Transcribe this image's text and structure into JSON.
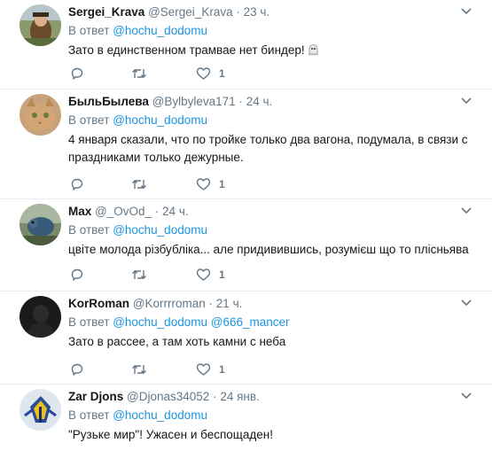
{
  "tweets": [
    {
      "name": "Sergei_Krava",
      "handle": "@Sergei_Krava",
      "dot": "·",
      "time": "23 ч.",
      "reply_prefix": "В ответ",
      "mentions": [
        "@hochu_dodomu"
      ],
      "text": "Зато в единственном трамвае нет биндер!",
      "emoji": "ghost-emoji",
      "likes": "1"
    },
    {
      "name": "БыльБылева",
      "handle": "@Bylbyleva171",
      "dot": "·",
      "time": "24 ч.",
      "reply_prefix": "В ответ",
      "mentions": [
        "@hochu_dodomu"
      ],
      "text": "4 января сказали, что по тройке только два вагона, подумала, в связи с праздниками только дежурные.",
      "likes": "1"
    },
    {
      "name": "Max",
      "handle": "@_OvOd_",
      "dot": "·",
      "time": "24 ч.",
      "reply_prefix": "В ответ",
      "mentions": [
        "@hochu_dodomu"
      ],
      "text": "цвіте молода різбубліка... але придивившись, розумієш що то плісньява",
      "likes": "1"
    },
    {
      "name": "KorRoman",
      "handle": "@Korrrroman",
      "dot": "·",
      "time": "21 ч.",
      "reply_prefix": "В ответ",
      "mentions": [
        "@hochu_dodomu",
        "@666_mancer"
      ],
      "text": "Зато в рассее, а там хоть камни с неба",
      "likes": "1"
    },
    {
      "name": "Zar Djons",
      "handle": "@Djonas34052",
      "dot": "·",
      "time": "24 янв.",
      "reply_prefix": "В ответ",
      "mentions": [
        "@hochu_dodomu"
      ],
      "text": "\"Рузьке мир\"! Ужасен и беспощаден!"
    }
  ],
  "icons": {
    "reply": "reply-icon",
    "retweet": "retweet-icon",
    "like": "heart-icon",
    "menu": "chevron-down-icon"
  },
  "colors": {
    "text": "#14171a",
    "secondary": "#657786",
    "link": "#1b95e0",
    "divider": "#e6ecf0"
  }
}
